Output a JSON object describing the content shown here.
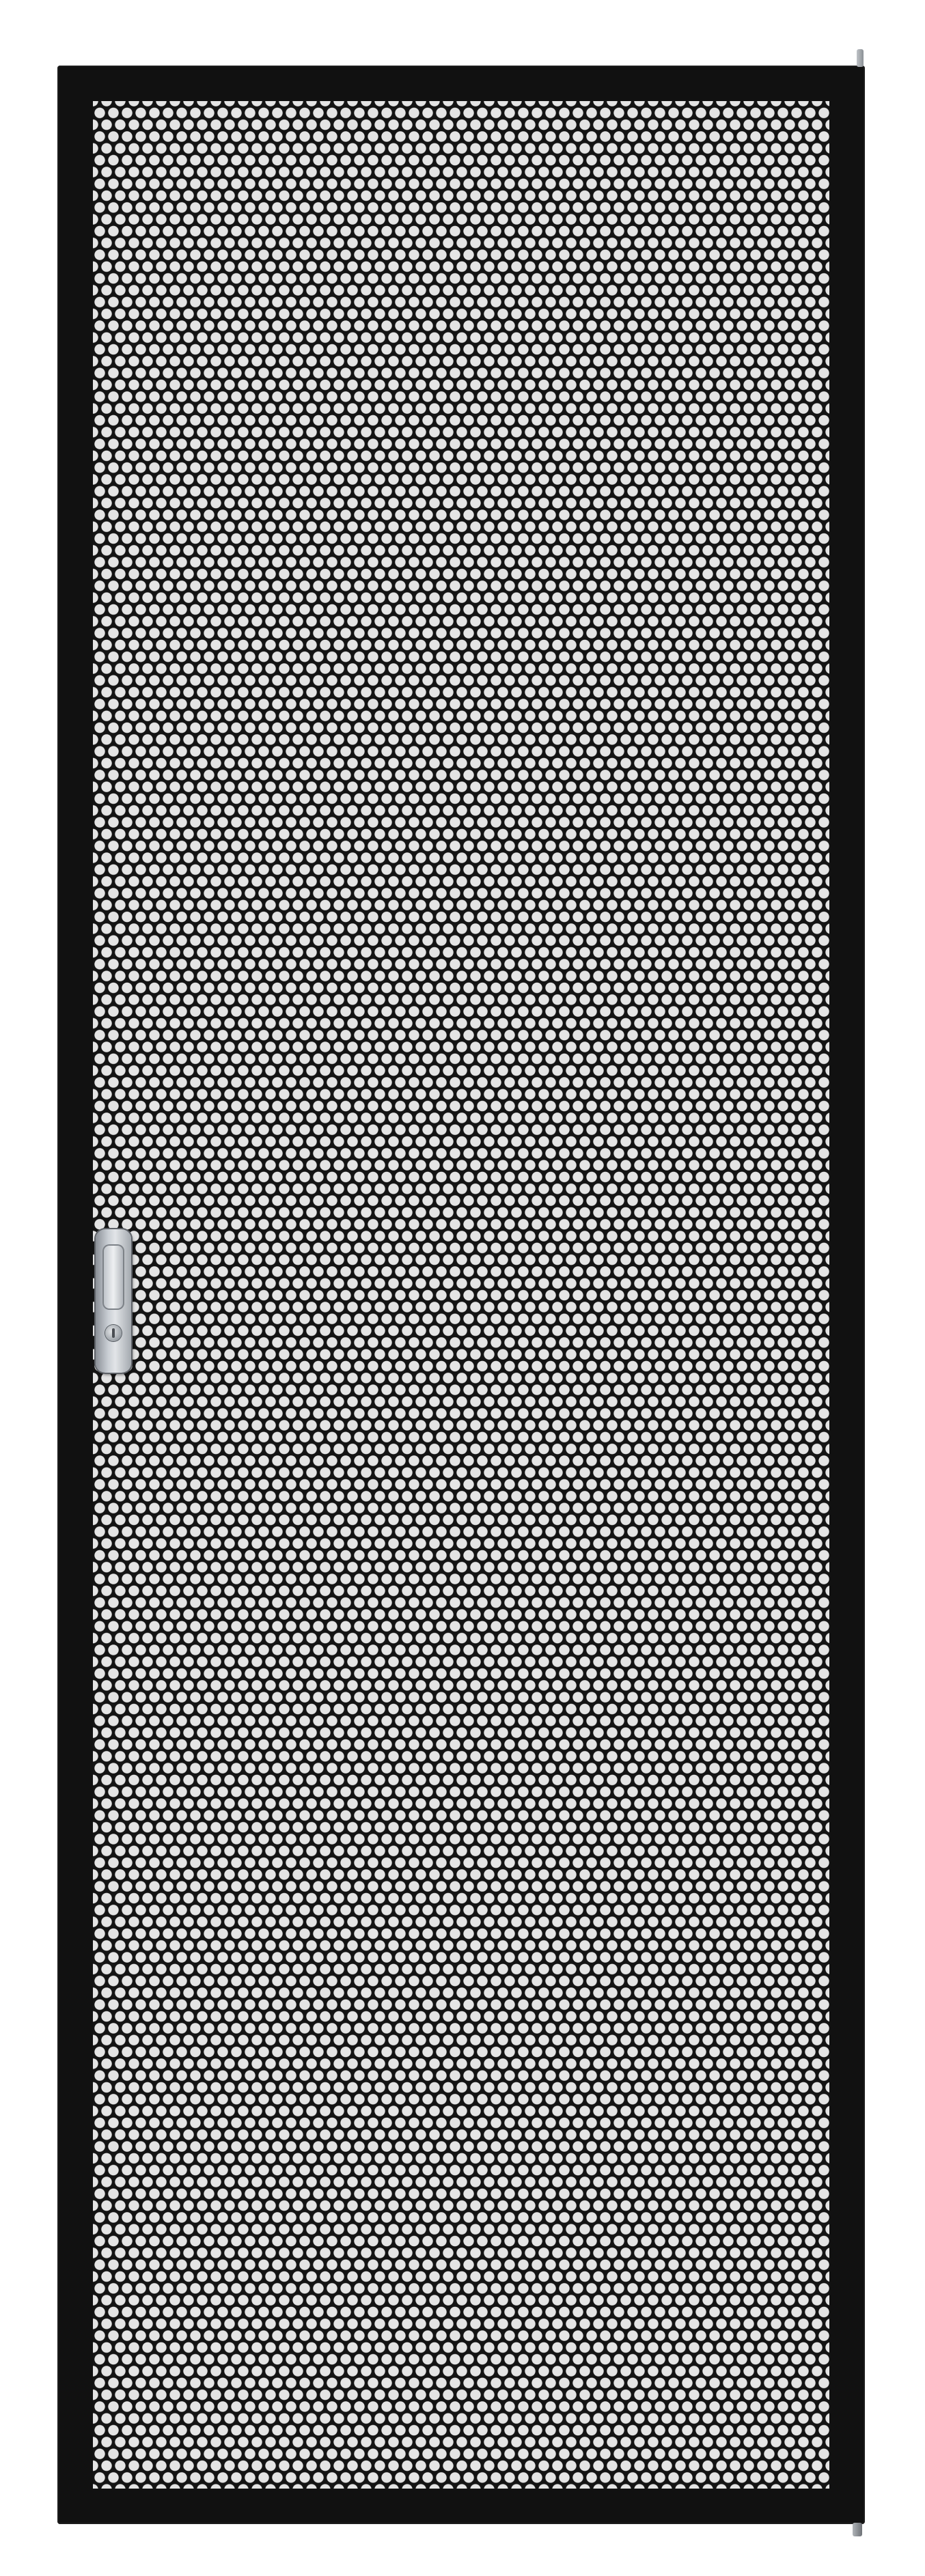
{
  "colors": {
    "frame": "#111111",
    "mesh_hole": "#e4e4e4",
    "handle": "#c9ced4",
    "background": "#ffffff"
  },
  "icons": {
    "handle": "door-handle-icon",
    "lock": "keyhole-icon"
  }
}
